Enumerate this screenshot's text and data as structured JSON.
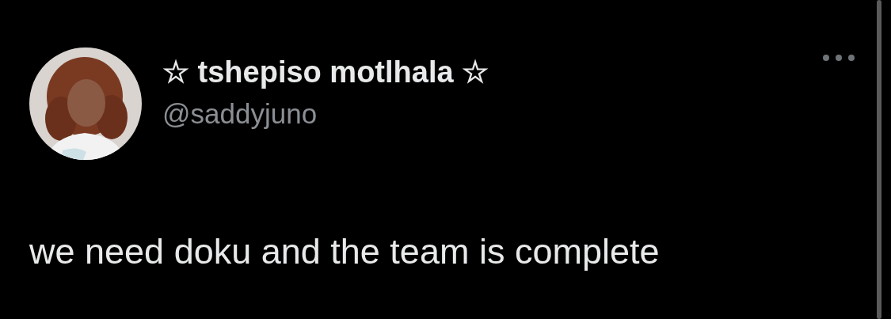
{
  "author": {
    "name": "☆ tshepiso motlhala ☆",
    "handle": "@saddyjuno"
  },
  "tweet": {
    "text": "we need doku and the team is complete"
  }
}
